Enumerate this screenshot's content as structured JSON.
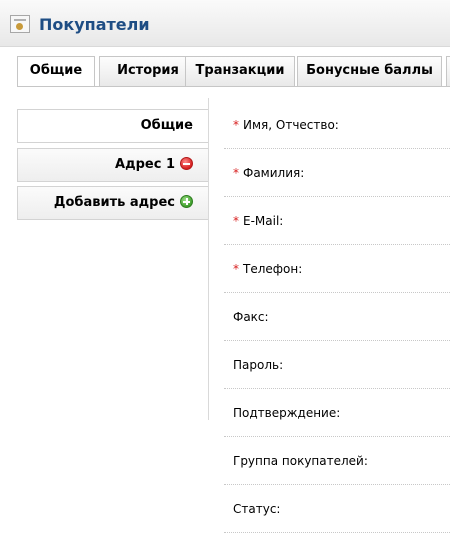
{
  "heading": {
    "title": "Покупатели",
    "icon": "customers-icon"
  },
  "tabs": [
    {
      "label": "Общие",
      "active": true
    },
    {
      "label": "История",
      "active": false
    },
    {
      "label": "Транзакции",
      "active": false
    },
    {
      "label": "Бонусные баллы",
      "active": false
    }
  ],
  "vtabs": [
    {
      "label": "Общие",
      "active": true
    },
    {
      "label": "Адрес 1",
      "icon": "remove-icon"
    },
    {
      "label": "Добавить адрес",
      "icon": "add-icon"
    }
  ],
  "form": {
    "firstname": {
      "label": "Имя, Отчество:",
      "required": true
    },
    "lastname": {
      "label": "Фамилия:",
      "required": true
    },
    "email": {
      "label": "E-Mail:",
      "required": true
    },
    "telephone": {
      "label": "Телефон:",
      "required": true
    },
    "fax": {
      "label": "Факс:",
      "required": false
    },
    "password": {
      "label": "Пароль:",
      "required": false
    },
    "confirm": {
      "label": "Подтверждение:",
      "required": false
    },
    "customer_group": {
      "label": "Группа покупателей:",
      "required": false
    },
    "status": {
      "label": "Статус:",
      "required": false
    }
  },
  "required_mark": "*",
  "colors": {
    "title": "#1e4d84",
    "required": "#d81f1f",
    "remove": "#d61f1f",
    "add": "#3f9e2c"
  }
}
